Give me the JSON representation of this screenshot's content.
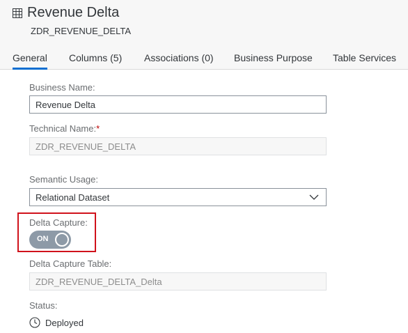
{
  "header": {
    "title": "Revenue Delta",
    "subtitle": "ZDR_REVENUE_DELTA",
    "icon": "table-icon"
  },
  "tabs": [
    {
      "label": "General",
      "active": true
    },
    {
      "label": "Columns (5)"
    },
    {
      "label": "Associations (0)"
    },
    {
      "label": "Business Purpose"
    },
    {
      "label": "Table Services"
    }
  ],
  "form": {
    "business_name_label": "Business Name:",
    "business_name_value": "Revenue Delta",
    "technical_name_label": "Technical Name:",
    "technical_name_required": "*",
    "technical_name_value": "ZDR_REVENUE_DELTA",
    "semantic_usage_label": "Semantic Usage:",
    "semantic_usage_value": "Relational Dataset",
    "delta_capture_label": "Delta Capture:",
    "delta_capture_toggle": "ON",
    "delta_capture_table_label": "Delta Capture Table:",
    "delta_capture_table_value": "ZDR_REVENUE_DELTA_Delta",
    "status_label": "Status:",
    "status_value": "Deployed"
  },
  "colors": {
    "accent": "#0a6ed1",
    "highlight_border": "#d0121b",
    "toggle_bg": "#8d9aa7"
  }
}
